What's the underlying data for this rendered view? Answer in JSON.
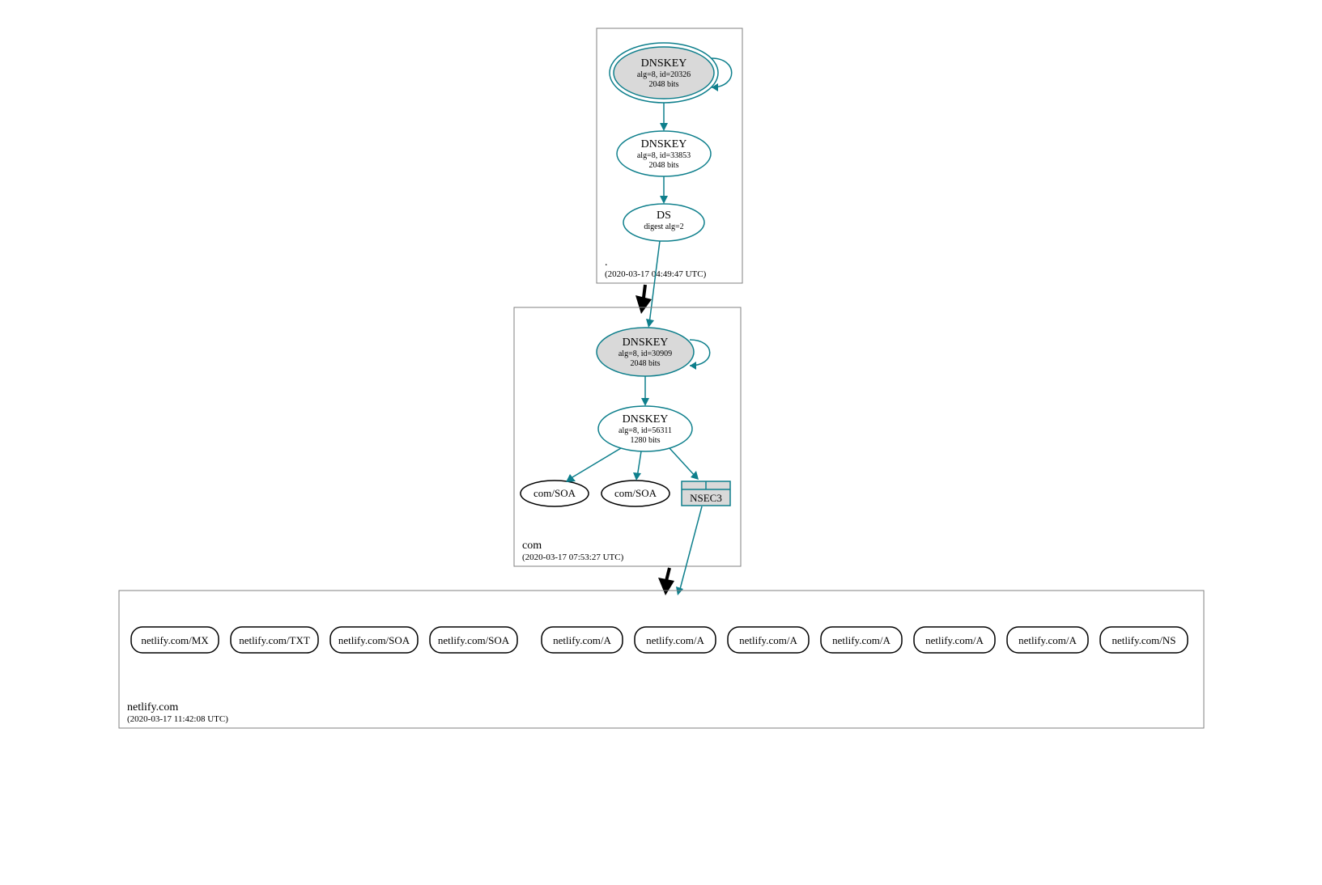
{
  "colors": {
    "teal": "#0e7f8c",
    "gray_fill": "#d9d9d9",
    "box_stroke": "#808080"
  },
  "zones": {
    "root": {
      "label": ".",
      "timestamp": "(2020-03-17 04:49:47 UTC)",
      "nodes": {
        "ksk": {
          "title": "DNSKEY",
          "line1": "alg=8, id=20326",
          "line2": "2048 bits"
        },
        "zsk": {
          "title": "DNSKEY",
          "line1": "alg=8, id=33853",
          "line2": "2048 bits"
        },
        "ds": {
          "title": "DS",
          "line1": "digest alg=2"
        }
      }
    },
    "com": {
      "label": "com",
      "timestamp": "(2020-03-17 07:53:27 UTC)",
      "nodes": {
        "ksk": {
          "title": "DNSKEY",
          "line1": "alg=8, id=30909",
          "line2": "2048 bits"
        },
        "zsk": {
          "title": "DNSKEY",
          "line1": "alg=8, id=56311",
          "line2": "1280 bits"
        },
        "soa1": "com/SOA",
        "soa2": "com/SOA",
        "nsec3": "NSEC3"
      }
    },
    "netlify": {
      "label": "netlify.com",
      "timestamp": "(2020-03-17 11:42:08 UTC)",
      "records": [
        "netlify.com/MX",
        "netlify.com/TXT",
        "netlify.com/SOA",
        "netlify.com/SOA",
        "netlify.com/A",
        "netlify.com/A",
        "netlify.com/A",
        "netlify.com/A",
        "netlify.com/A",
        "netlify.com/A",
        "netlify.com/NS"
      ]
    }
  }
}
